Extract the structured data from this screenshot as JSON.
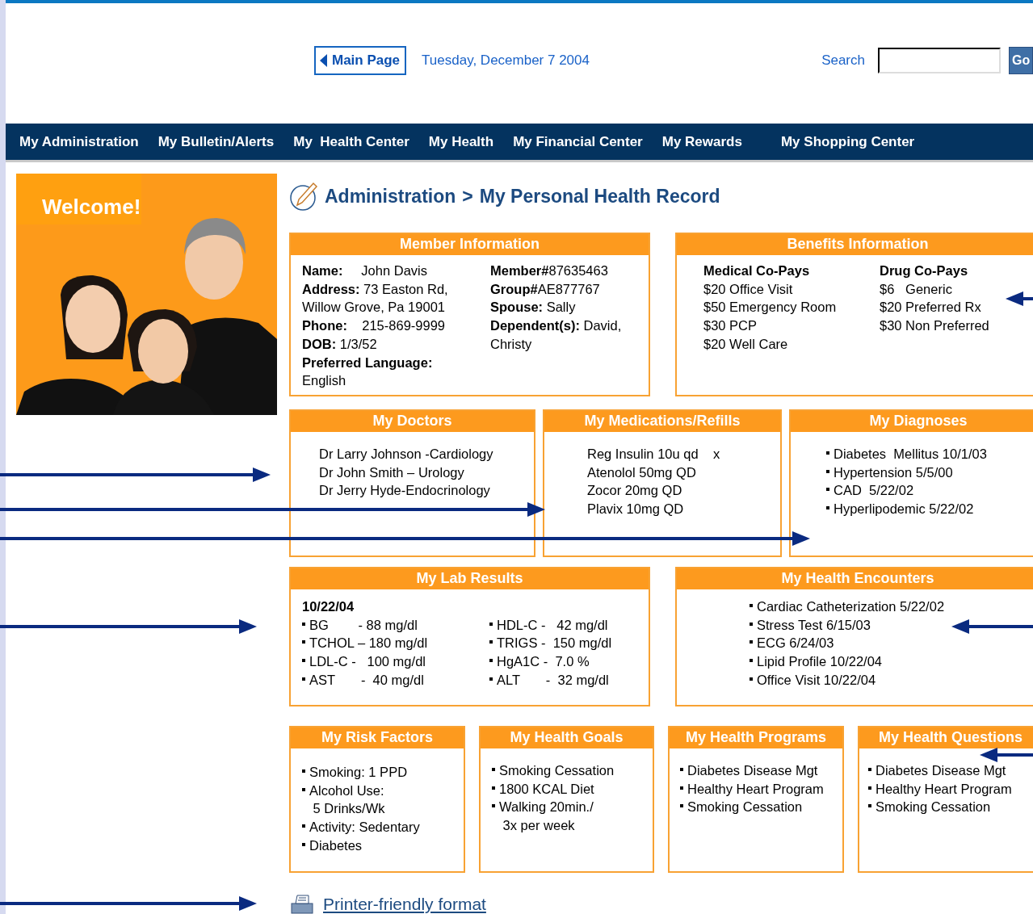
{
  "header": {
    "main_page_button": "Main Page",
    "date": "Tuesday, December 7 2004",
    "search_label": "Search",
    "go_button": "Go"
  },
  "nav": [
    "My Administration",
    "My Bulletin/Alerts",
    "My  Health Center",
    "My Health",
    "My Financial Center",
    "My Rewards",
    "My Shopping Center"
  ],
  "welcome": {
    "title": "Welcome!",
    "kind": "picture"
  },
  "breadcrumb": {
    "section": "Administration",
    "separator": ">",
    "page": "My Personal Health Record"
  },
  "panel_rows": [
    [
      {
        "title": "Member Information",
        "kind": "columns",
        "columns": [
          {
            "lines": [
              "**Name:**     John Davis",
              "**Address:** 73 Easton Rd,",
              "Willow Grove, Pa 19001",
              "**Phone:**    215-869-9999",
              "**DOB:** 1/3/52",
              "**Preferred Language:**",
              "English"
            ]
          },
          {
            "lines": [
              "**Member#**87635463",
              "**Group#**AE877767",
              "**Spouse:** Sally",
              "**Dependent(s):** David,",
              "Christy"
            ]
          }
        ]
      },
      {
        "title": "Benefits Information",
        "kind": "columns",
        "columns": [
          {
            "heading": "Medical Co-Pays",
            "lines": [
              "$20 Office Visit",
              "$50 Emergency Room",
              "$30 PCP",
              "$20 Well Care"
            ]
          },
          {
            "heading": "Drug Co-Pays",
            "lines": [
              "$6   Generic",
              "$20 Preferred Rx",
              "$30 Non Preferred"
            ]
          }
        ]
      }
    ],
    [
      {
        "title": "My Doctors",
        "kind": "lines",
        "lines": [
          "Dr Larry Johnson -Cardiology",
          "Dr John Smith – Urology",
          "Dr Jerry Hyde-Endocrinology"
        ]
      },
      {
        "title": "My Medications/Refills",
        "kind": "lines",
        "lines": [
          "Reg Insulin 10u qd    x",
          "Atenolol 50mg QD",
          "Zocor 20mg QD",
          "Plavix 10mg QD"
        ]
      },
      {
        "title": "My Diagnoses",
        "kind": "bullets",
        "items": [
          "Diabetes  Mellitus 10/1/03",
          "Hypertension 5/5/00",
          "CAD  5/22/02",
          "Hyperlipodemic 5/22/02"
        ]
      }
    ],
    [
      {
        "title": "My Lab Results",
        "kind": "bullet_columns",
        "heading": "10/22/04",
        "columns": [
          [
            "BG        - 88 mg/dl",
            "TCHOL – 180 mg/dl",
            "LDL-C -   100 mg/dl",
            "AST       -  40 mg/dl"
          ],
          [
            "HDL-C -   42 mg/dl",
            "TRIGS -  150 mg/dl",
            "HgA1C -  7.0 %",
            "ALT       -  32 mg/dl"
          ]
        ]
      },
      {
        "title": "My Health Encounters",
        "kind": "bullets",
        "items": [
          "Cardiac Catheterization 5/22/02",
          "Stress Test 6/15/03",
          "ECG 6/24/03",
          "Lipid Profile 10/22/04",
          "Office Visit 10/22/04"
        ]
      }
    ],
    [
      {
        "title": "My Risk Factors",
        "kind": "bullets",
        "items": [
          "Smoking: 1 PPD",
          "Alcohol Use:\n 5 Drinks/Wk",
          "Activity: Sedentary",
          "Diabetes"
        ]
      },
      {
        "title": "My Health Goals",
        "kind": "bullets",
        "items": [
          "Smoking Cessation",
          "1800 KCAL Diet",
          "Walking 20min./\n 3x per week"
        ]
      },
      {
        "title": "My Health Programs",
        "kind": "bullets",
        "items": [
          "Diabetes Disease Mgt",
          "Healthy Heart Program",
          "Smoking Cessation"
        ]
      },
      {
        "title": "My Health Questions",
        "kind": "bullets",
        "items": [
          "Diabetes Disease Mgt",
          "Healthy Heart Program",
          "Smoking Cessation"
        ]
      }
    ]
  ],
  "printer_link": "Printer-friendly format"
}
